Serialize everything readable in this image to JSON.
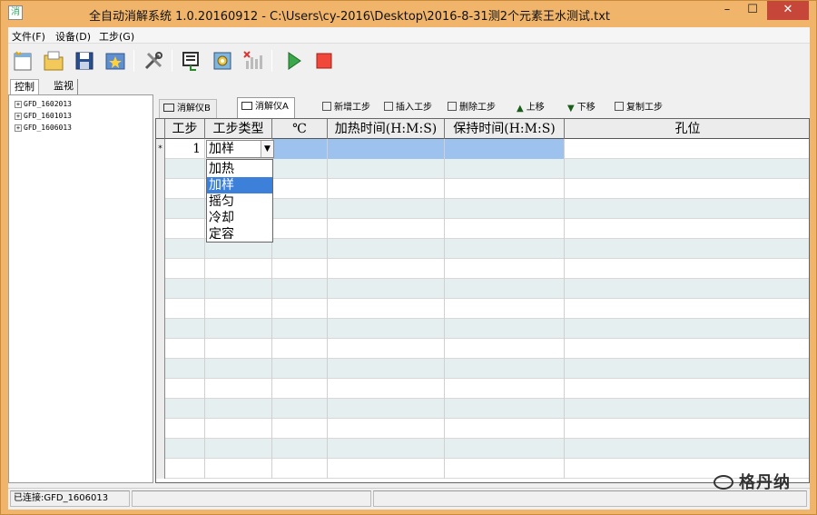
{
  "window": {
    "title": "全自动消解系统 1.0.20160912 - C:\\Users\\cy-2016\\Desktop\\2016-8-31测2个元素王水测试.txt",
    "app_icon": "消",
    "min_glyph": "–",
    "max_glyph": "☐",
    "close_glyph": "✕"
  },
  "menu": {
    "items": [
      {
        "label": "文件(F)"
      },
      {
        "label": "设备(D)"
      },
      {
        "label": "工步(G)"
      }
    ]
  },
  "toolbar": {
    "buttons": [
      {
        "icon": "new-file-icon"
      },
      {
        "icon": "open-folder-icon"
      },
      {
        "icon": "save-icon"
      },
      {
        "icon": "favorite-icon"
      },
      {
        "icon": "tools-icon"
      },
      {
        "icon": "connect-icon"
      },
      {
        "icon": "device-settings-icon"
      },
      {
        "icon": "chart-disabled-icon"
      },
      {
        "icon": "play-icon"
      },
      {
        "icon": "stop-icon"
      }
    ]
  },
  "panel_tabs": {
    "control": "控制",
    "monitor": "监视"
  },
  "tree": {
    "items": [
      {
        "label": "GFD_1602013"
      },
      {
        "label": "GFD_1601013"
      },
      {
        "label": "GFD_1606013"
      }
    ],
    "expand_glyph": "+"
  },
  "sub_toolbar": {
    "tab_b": "消解仪B",
    "tab_a": "消解仪A",
    "add_step": "新增工步",
    "insert_step": "插入工步",
    "delete_step": "删除工步",
    "move_up": "上移",
    "move_down": "下移",
    "copy_step": "复制工步",
    "up_glyph": "▲",
    "down_glyph": "▼"
  },
  "grid": {
    "columns": [
      {
        "label": "工步"
      },
      {
        "label": "工步类型"
      },
      {
        "label": "℃"
      },
      {
        "label": "加热时间(H:M:S)"
      },
      {
        "label": "保持时间(H:M:S)"
      },
      {
        "label": "孔位"
      }
    ],
    "rows": [
      {
        "marker": "*",
        "step": "1",
        "type": "加样",
        "temp": "",
        "heat_time": "",
        "hold_time": "",
        "position": ""
      }
    ],
    "combo_arrow": "▼",
    "dropdown_options": [
      {
        "label": "加热"
      },
      {
        "label": "加样"
      },
      {
        "label": "摇匀"
      },
      {
        "label": "冷却"
      },
      {
        "label": "定容"
      }
    ],
    "dropdown_selected": "加样"
  },
  "status": {
    "connection": "已连接:GFD_1606013"
  },
  "watermark": {
    "text": "格丹纳"
  },
  "colors": {
    "title_bar": "#f0b46a",
    "selection": "#3c80d9",
    "cell_selected": "#9ec2ee",
    "alt_row": "#e6efef",
    "close_button": "#c7463a"
  }
}
